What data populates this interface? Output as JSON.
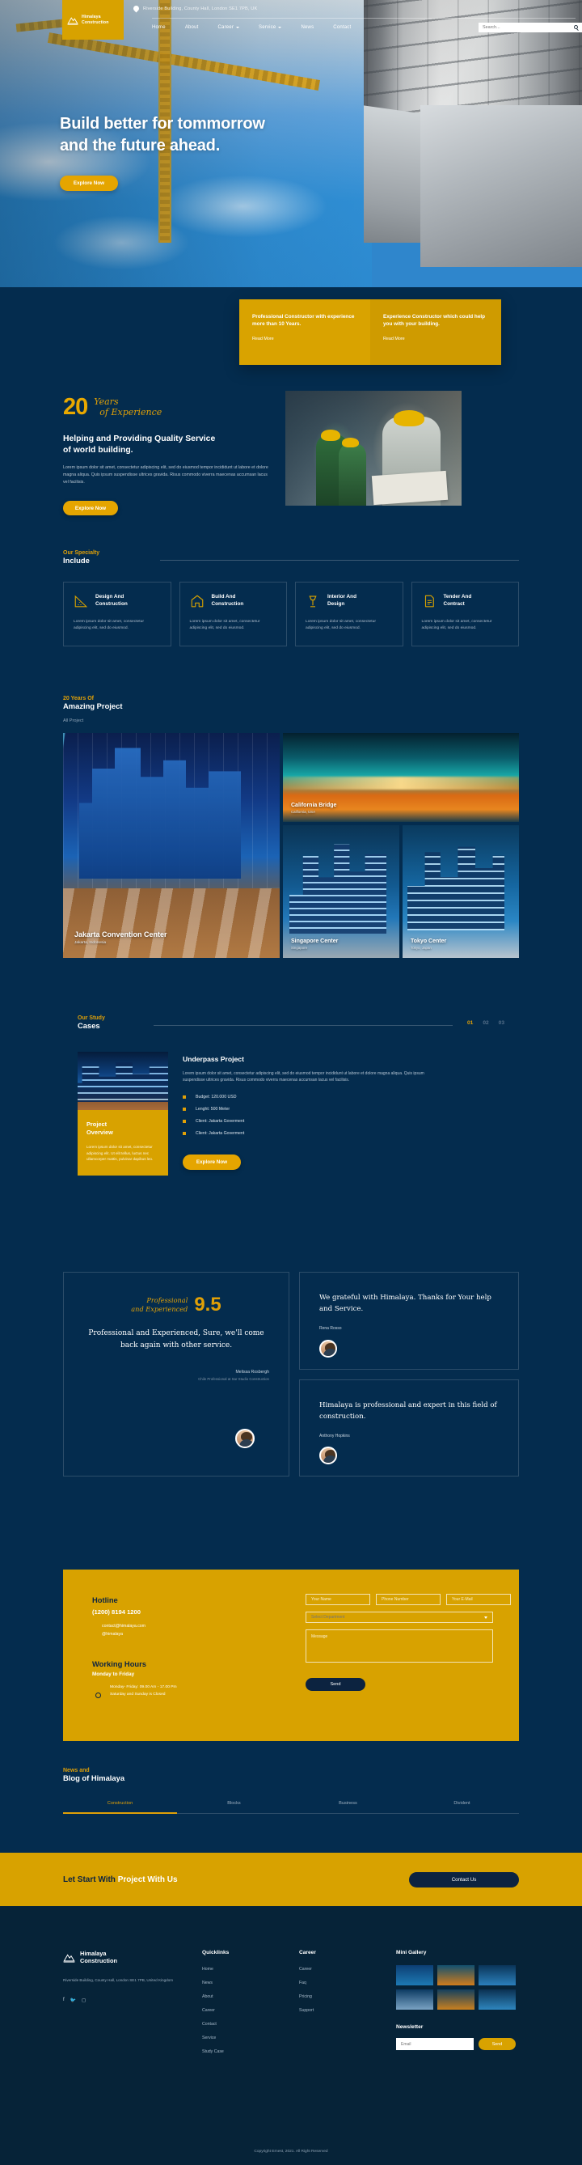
{
  "brand": {
    "name_line1": "Himalaya",
    "name_line2": "Construction",
    "logo_icon": "mountain-icon"
  },
  "topbar": {
    "address": "Riverside Building, County Hall, London SE1 7PB, UK",
    "address_icon": "location-pin-icon",
    "nav": [
      {
        "label": "Home",
        "has_dropdown": false
      },
      {
        "label": "About",
        "has_dropdown": false
      },
      {
        "label": "Career",
        "has_dropdown": true
      },
      {
        "label": "Service",
        "has_dropdown": true
      },
      {
        "label": "News",
        "has_dropdown": false
      },
      {
        "label": "Contact",
        "has_dropdown": false
      }
    ],
    "search_placeholder": "Search...",
    "search_icon": "search-icon"
  },
  "hero": {
    "title_line1": "Build better for tommorrow",
    "title_line2": "and the future ahead.",
    "cta": "Explore Now"
  },
  "dual_banner": [
    {
      "title": "Professional Constructor with experience more than 10 Years.",
      "link": "Read More"
    },
    {
      "title": "Experience Constructor which could help you with your building.",
      "link": "Read More"
    }
  ],
  "years": {
    "number": "20",
    "script_line1": "Years",
    "script_line2": "of Experience",
    "heading_line1": "Helping and Providing Quality Service",
    "heading_line2": "of world building.",
    "paragraph": "Lorem ipsum dolor sit amet, consectetur adipiscing elit, sed do eiusmod tempor incididunt ut labore et dolore magna aliqua. Quis ipsum suspendisse ultrices gravida. Risus commodo viverra maecenas accumsan lacus vel facilisis.",
    "cta": "Explore Now"
  },
  "specialty": {
    "eyebrow": "Our Specialty",
    "title": "Include",
    "cards": [
      {
        "icon": "ruler-triangle-icon",
        "title_line1": "Design And",
        "title_line2": "Construction",
        "text": "Lorem ipsum dolor sit amet, consectetur adipiscing elit, sed do eiusmod."
      },
      {
        "icon": "house-icon",
        "title_line1": "Build And",
        "title_line2": "Construction",
        "text": "Lorem ipsum dolor sit amet, consectetur adipiscing elit, sed do eiusmod."
      },
      {
        "icon": "lamp-icon",
        "title_line1": "Interior And",
        "title_line2": "Design",
        "text": "Lorem ipsum dolor sit amet, consectetur adipiscing elit, sed do eiusmod."
      },
      {
        "icon": "document-icon",
        "title_line1": "Tender And",
        "title_line2": "Contract",
        "text": "Lorem ipsum dolor sit amet, consectetur adipiscing elit, sed do eiusmod."
      }
    ]
  },
  "projects": {
    "eyebrow": "20 Years Of",
    "title": "Amazing Project",
    "filter": "All Project",
    "items": [
      {
        "name": "Jakarta Convention Center",
        "location": "Jakarta, Indonesia"
      },
      {
        "name": "California Bridge",
        "location": "California, USA"
      },
      {
        "name": "Singapore Center",
        "location": "Singapore"
      },
      {
        "name": "Tokyo Center",
        "location": "Tokyo, Japan"
      }
    ]
  },
  "cases": {
    "eyebrow": "Our Study",
    "title": "Cases",
    "pager": [
      "01",
      "02",
      "03"
    ],
    "active_page": "01",
    "overview_title_line1": "Project",
    "overview_title_line2": "Overview",
    "overview_text": "Lorem ipsum dolor sit amet, consectetur adipiscing elit. Ut elit tellus, luctus nec ullamcorper mattis, pulvinar dapibus leo.",
    "project_title": "Underpass Project",
    "project_text": "Lorem ipsum dolor sit amet, consectetur adipiscing elit, sed do eiusmod tempor incididunt ut labore et dolore magna aliqua. Quis ipsum suspendisse ultrices gravida. Risus commodo viverra maecenas accumsan lacus vel facilisis.",
    "facts": [
      "Budget: 120.000 USD",
      "Lenght: 500 Meter",
      "Client: Jakarta Goverment",
      "Client: Jakarta Goverment"
    ],
    "cta": "Explore Now"
  },
  "testimonials": {
    "score_line1": "Professional",
    "score_line2": "and Experienced",
    "score": "9.5",
    "main_quote": "Professional and Experienced, Sure, we'll come back again with other service.",
    "main_name": "Melissa Rosbergh",
    "main_role": "Chile Professional at Sar Studio Construction",
    "items": [
      {
        "quote": "We grateful with Himalaya. Thanks for Your help and Service.",
        "name": "Rena Rosso"
      },
      {
        "quote": "Himalaya is professional and expert in this field of construction.",
        "name": "Anthony Hopkins"
      }
    ]
  },
  "contact": {
    "hotline_label": "Hotline",
    "hotline_number": "(1200) 8194 1200",
    "email": "contact@himalaya.com",
    "handle": "@himalaya",
    "hours_label": "Working Hours",
    "hours_days": "Monday to Friday",
    "hours_line1": "Monday- Friday: 09.00 Am - 17.00 Pm",
    "hours_line2": "Saturday and Sunday is Closed",
    "clock_icon": "clock-icon",
    "form": {
      "name_placeholder": "Your Name",
      "phone_placeholder": "Phone Number",
      "email_placeholder": "Your E-Mail",
      "department_placeholder": "Select Department",
      "message_placeholder": "Message",
      "submit": "Send",
      "lock_icon": "lock-icon"
    }
  },
  "news": {
    "eyebrow": "News and",
    "title": "Blog of Himalaya",
    "tabs": [
      "Construction",
      "Blocks",
      "Business",
      "Divident"
    ],
    "active_tab": "Construction"
  },
  "cta_bar": {
    "text_dark": "Let Start With",
    "text_light": "Project With Us",
    "button": "Contact Us"
  },
  "footer": {
    "brand_line1": "Himalaya",
    "brand_line2": "Construction",
    "address": "Riverside Building, County Hall, London SE1 7PB, United Kingdom",
    "socials": [
      "facebook-icon",
      "twitter-icon",
      "instagram-icon"
    ],
    "columns": [
      {
        "heading": "Quicklinks",
        "links": [
          "Home",
          "News",
          "About",
          "Career",
          "Contact",
          "Service",
          "Study Case"
        ]
      },
      {
        "heading": "Career",
        "links": [
          "Career",
          "Faq",
          "Pricing",
          "Support"
        ]
      }
    ],
    "gallery_heading": "Mini Gallery",
    "newsletter_heading": "Newsletter",
    "newsletter_placeholder": "Email",
    "newsletter_button": "Send",
    "copyright": "Copyright Ernest, 2021. All Right Reserved"
  }
}
